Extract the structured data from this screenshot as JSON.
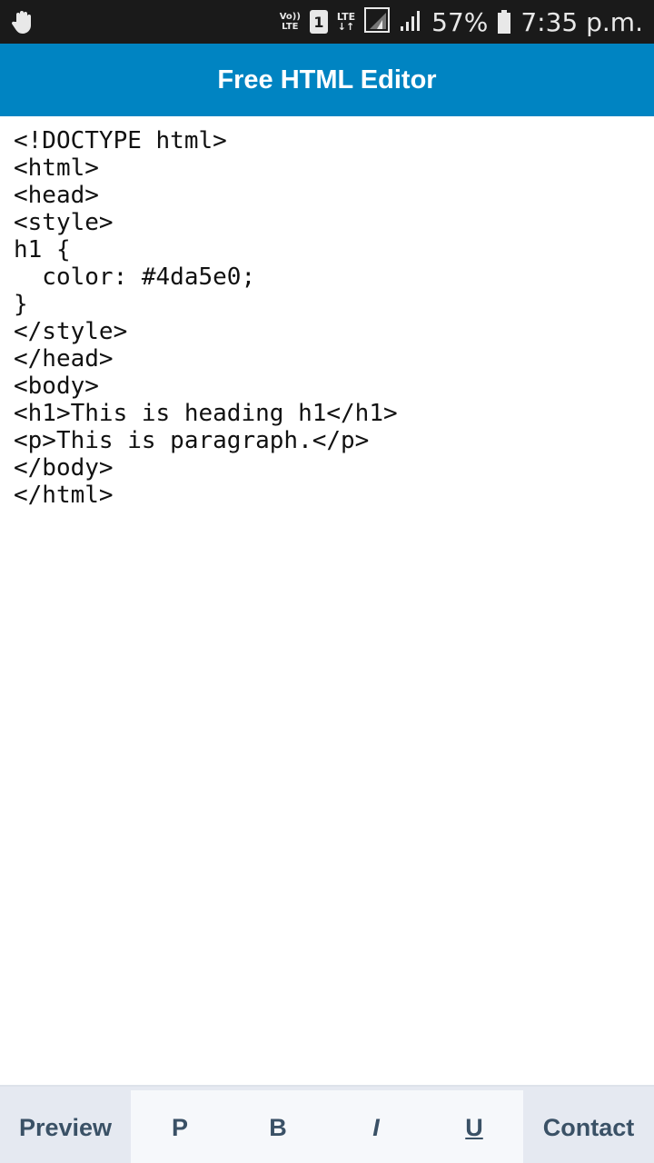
{
  "status_bar": {
    "left_icon": "hand-icon",
    "volte_top": "Vo))",
    "volte_bottom": "LTE",
    "sim_slot": "1",
    "lte_label": "LTE",
    "lte_arrows": "↓↑",
    "battery_percent": "57%",
    "time": "7:35 p.m."
  },
  "app_bar": {
    "title": "Free HTML Editor",
    "color": "#0084c2"
  },
  "editor": {
    "lines": [
      "<!DOCTYPE html>",
      "<html>",
      "<head>",
      "<style>",
      "h1 {",
      "  color: #4da5e0;",
      "}",
      "</style>",
      "</head>",
      "<body>",
      "<h1>This is heading h1</h1>",
      "<p>This is paragraph.</p>",
      "</body>",
      "</html>"
    ]
  },
  "toolbar": {
    "preview": "Preview",
    "p": "P",
    "b": "B",
    "i": "I",
    "u": "U",
    "contact": "Contact"
  }
}
